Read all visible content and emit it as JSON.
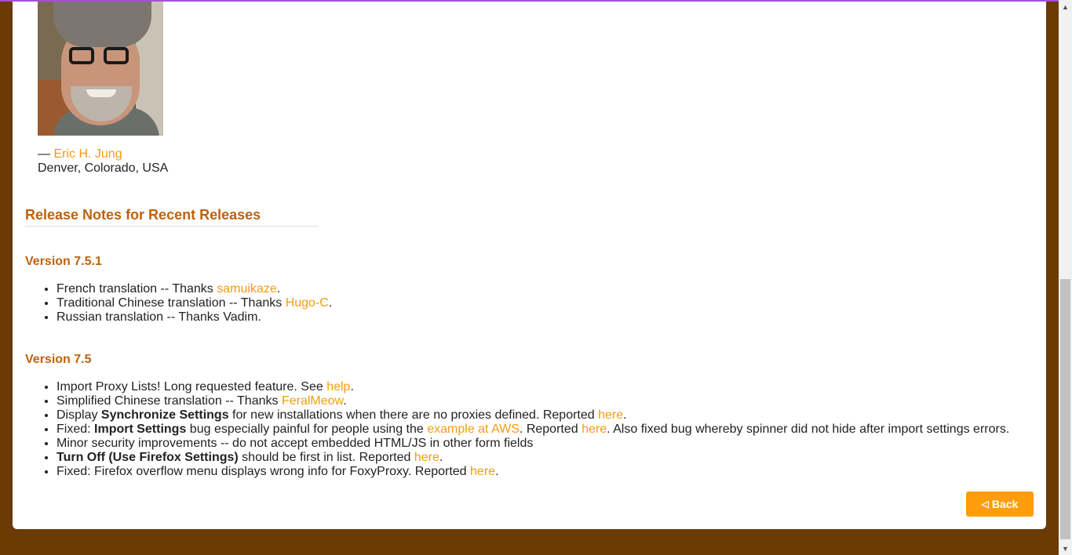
{
  "author": {
    "dash": "— ",
    "name": "Eric H. Jung",
    "location": "Denver, Colorado, USA"
  },
  "section_title": "Release Notes for Recent Releases",
  "releases": [
    {
      "version": "Version 7.5.1",
      "items": [
        {
          "a": "French translation -- Thanks ",
          "link": "samuikaze",
          "b": "."
        },
        {
          "a": "Traditional Chinese translation -- Thanks ",
          "link": "Hugo-C",
          "b": "."
        },
        {
          "a": "Russian translation -- Thanks Vadim."
        }
      ]
    },
    {
      "version": "Version 7.5",
      "items": [
        {
          "a": "Import Proxy Lists! Long requested feature. See ",
          "link": "help",
          "b": "."
        },
        {
          "a": "Simplified Chinese translation -- Thanks ",
          "link": "FeralMeow",
          "b": "."
        },
        {
          "a": "Display ",
          "bold": "Synchronize Settings",
          "b": " for new installations when there are no proxies defined. Reported ",
          "link": "here",
          "c": "."
        },
        {
          "a": "Fixed: ",
          "bold": "Import Settings",
          "b": " bug especially painful for people using the ",
          "link": "example at AWS",
          "c": ". Reported ",
          "link2": "here",
          "d": ". Also fixed bug whereby spinner did not hide after import settings errors."
        },
        {
          "a": "Minor security improvements -- do not accept embedded HTML/JS in other form fields"
        },
        {
          "bold": "Turn Off (Use Firefox Settings)",
          "b": " should be first in list. Reported ",
          "link": "here",
          "c": "."
        },
        {
          "a": "Fixed: Firefox overflow menu displays wrong info for FoxyProxy. Reported ",
          "link": "here",
          "b": "."
        }
      ]
    }
  ],
  "back_button": {
    "icon": "◁",
    "label": "Back"
  },
  "scrollbar": {
    "up": "▲",
    "down": "▼"
  },
  "colors": {
    "accent": "#f39c12",
    "heading": "#c0620c",
    "page_bg": "#6b3a05",
    "button": "#ff9d0a"
  }
}
